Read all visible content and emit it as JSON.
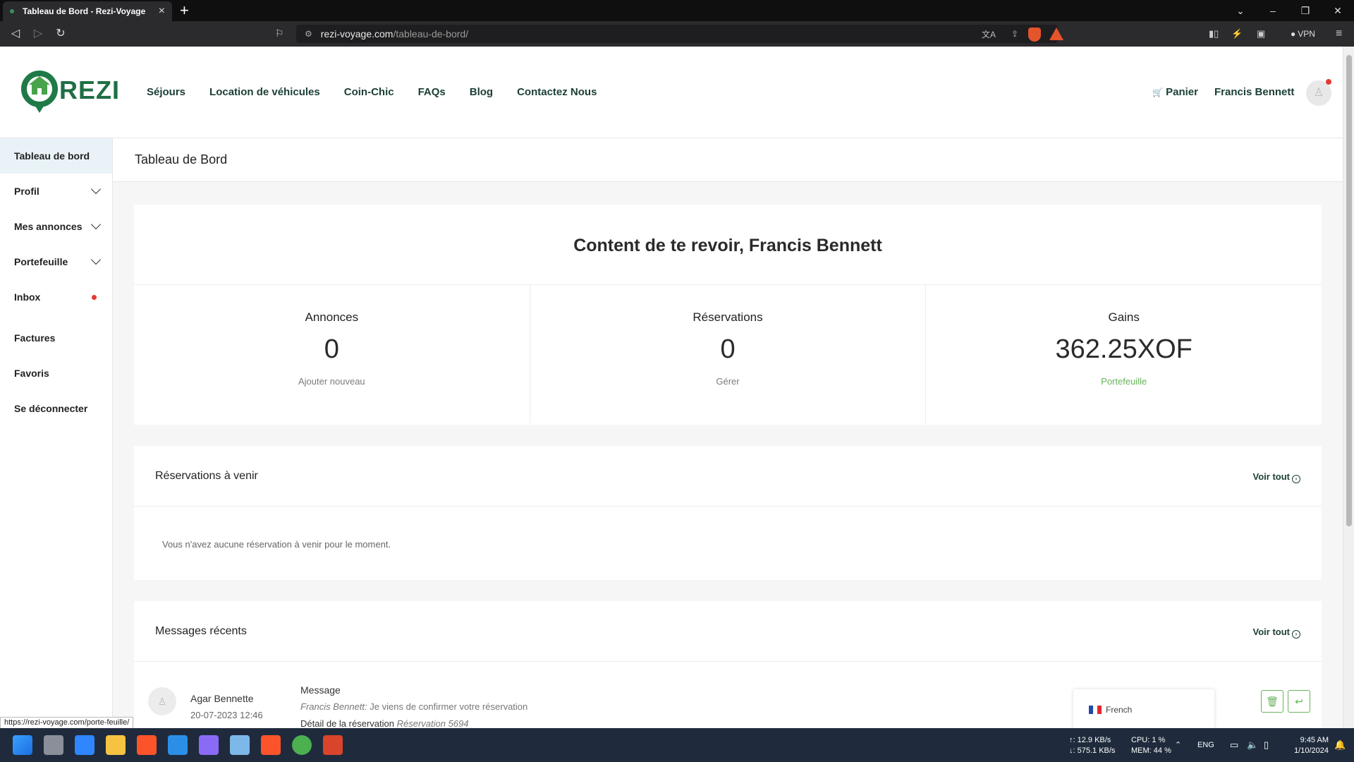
{
  "browser": {
    "tab_title": "Tableau de Bord - Rezi-Voyage",
    "url_host": "rezi-voyage.com",
    "url_path": "/tableau-de-bord/",
    "vpn_label": "VPN"
  },
  "site": {
    "logo_text": "REZI",
    "nav": [
      "Séjours",
      "Location de véhicules",
      "Coin-Chic",
      "FAQs",
      "Blog",
      "Contactez Nous"
    ],
    "cart_label": "Panier",
    "user_name": "Francis Bennett"
  },
  "sidebar": {
    "items": [
      {
        "label": "Tableau de bord",
        "active": true
      },
      {
        "label": "Profil",
        "chevron": true
      },
      {
        "label": "Mes annonces",
        "chevron": true
      },
      {
        "label": "Portefeuille",
        "chevron": true
      },
      {
        "label": "Inbox",
        "badge": true
      },
      {
        "label": "Factures"
      },
      {
        "label": "Favoris"
      },
      {
        "label": "Se déconnecter"
      }
    ]
  },
  "dashboard": {
    "page_title": "Tableau de Bord",
    "welcome": "Content de te revoir, Francis Bennett",
    "stats": [
      {
        "label": "Annonces",
        "value": "0",
        "link": "Ajouter nouveau"
      },
      {
        "label": "Réservations",
        "value": "0",
        "link": "Gérer"
      },
      {
        "label": "Gains",
        "value": "362.25XOF",
        "link": "Portefeuille"
      }
    ],
    "upcoming": {
      "title": "Réservations à venir",
      "view_all": "Voir tout",
      "empty": "Vous n'avez aucune réservation à venir pour le moment."
    },
    "messages": {
      "title": "Messages récents",
      "view_all": "Voir tout",
      "item": {
        "name": "Agar Bennette",
        "date": "20-07-2023 12:46",
        "heading": "Message",
        "sender": "Francis Bennett:",
        "text": "Je viens de confirmer votre réservation",
        "detail_label": "Détail de la réservation",
        "detail_ref": "Réservation 5694"
      }
    }
  },
  "language": {
    "label": "French"
  },
  "status_url": "https://rezi-voyage.com/porte-feuille/",
  "taskbar": {
    "net_up": "↑: 12.9 KB/s",
    "net_down": "↓: 575.1 KB/s",
    "cpu": "CPU: 1 %",
    "mem": "MEM: 44 %",
    "lang": "ENG",
    "time": "9:45 AM",
    "date": "1/10/2024"
  },
  "colors": {
    "brand_green": "#1f7a47",
    "accent_green": "#67b35b",
    "nav_text": "#1a3e35",
    "alert_red": "#e53935"
  }
}
